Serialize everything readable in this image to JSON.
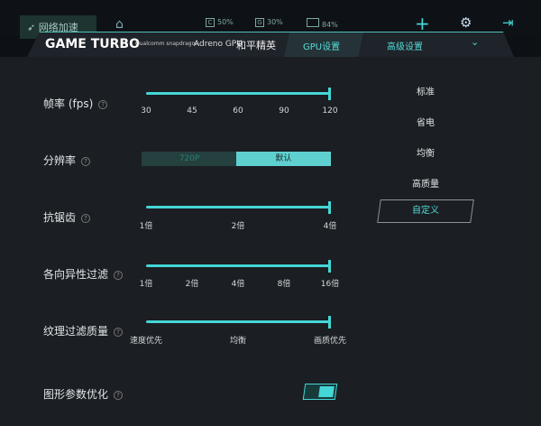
{
  "topbar": {
    "network_boost": "网络加速",
    "cpu": "50%",
    "cpu_icon": "C",
    "gpu": "30%",
    "gpu_icon": "G",
    "battery": "84%"
  },
  "header": {
    "title": "GAME TURBO",
    "chip_brand": "Qualcomm snapdragon",
    "gpu": "Adreno GPU",
    "game": "和平精英",
    "tabs": [
      "GPU设置",
      "高级设置"
    ],
    "active_tab": "GPU设置"
  },
  "settings": {
    "fps": {
      "label": "帧率 (fps)",
      "ticks": [
        "30",
        "45",
        "60",
        "90",
        "120"
      ],
      "value": "120"
    },
    "resolution": {
      "label": "分辨率",
      "options": [
        "720P",
        "默认"
      ],
      "selected": "默认"
    },
    "aa": {
      "label": "抗锯齿",
      "ticks": [
        "1倍",
        "2倍",
        "4倍"
      ],
      "value": "4倍"
    },
    "aniso": {
      "label": "各向异性过滤",
      "ticks": [
        "1倍",
        "2倍",
        "4倍",
        "8倍",
        "16倍"
      ],
      "value": "16倍"
    },
    "texture": {
      "label": "纹理过滤质量",
      "ticks": [
        "速度优先",
        "均衡",
        "画质优先"
      ],
      "value": "画质优先"
    },
    "graphics_opt": {
      "label": "图形参数优化",
      "enabled": true
    }
  },
  "presets": [
    "标准",
    "省电",
    "均衡",
    "高质量",
    "自定义"
  ],
  "selected_preset": "自定义",
  "colors": {
    "accent": "#45d6d6",
    "bg": "#1b1e23"
  }
}
